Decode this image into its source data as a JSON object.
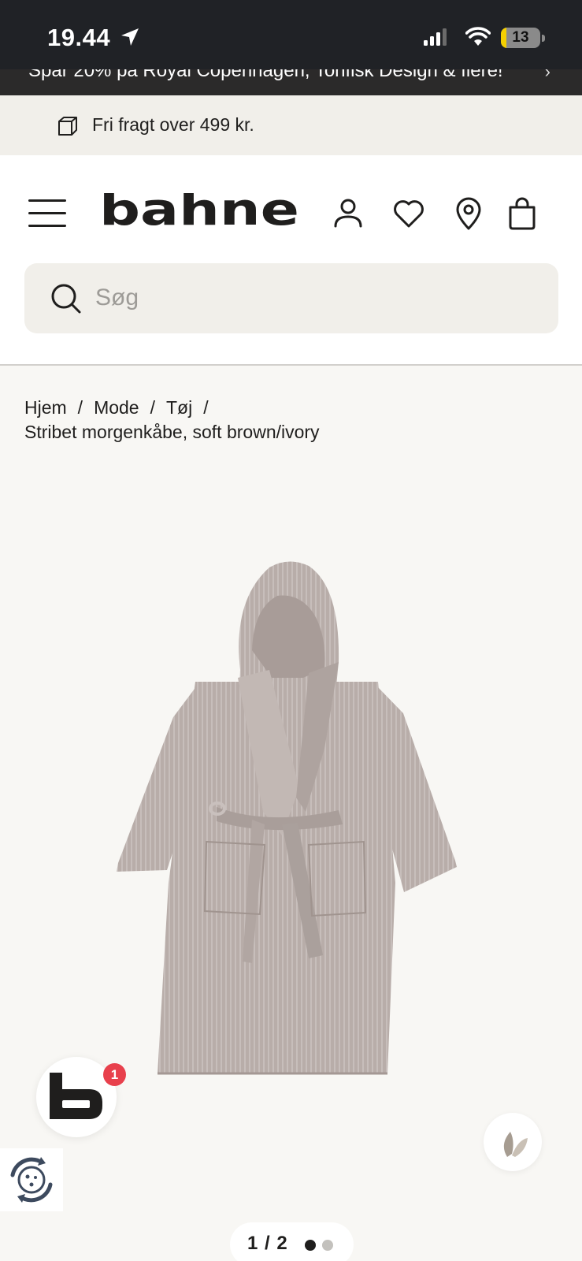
{
  "status_bar": {
    "time": "19.44",
    "battery": "13",
    "battery_level_percent": 13
  },
  "promo_banner": {
    "text": "Spar 20% på Royal Copenhagen, Tonfisk Design & flere!"
  },
  "shipping_banner": {
    "text": "Fri fragt over 499 kr."
  },
  "header": {
    "logo": "bahne",
    "icons": [
      "menu-icon",
      "user-icon",
      "heart-icon",
      "location-pin-icon",
      "shopping-bag-icon"
    ]
  },
  "search": {
    "placeholder": "Søg"
  },
  "breadcrumb": {
    "items": [
      "Hjem",
      "Mode",
      "Tøj"
    ],
    "separator": "/",
    "current": "Stribet morgenkåbe, soft brown/ivory"
  },
  "chat_badge": {
    "count": "1"
  },
  "pager": {
    "text": "1 / 2",
    "current": 1,
    "total": 2
  },
  "colors": {
    "accent_badge": "#e8404c",
    "status_bar": "#202226",
    "product": "#b6aaa6"
  }
}
